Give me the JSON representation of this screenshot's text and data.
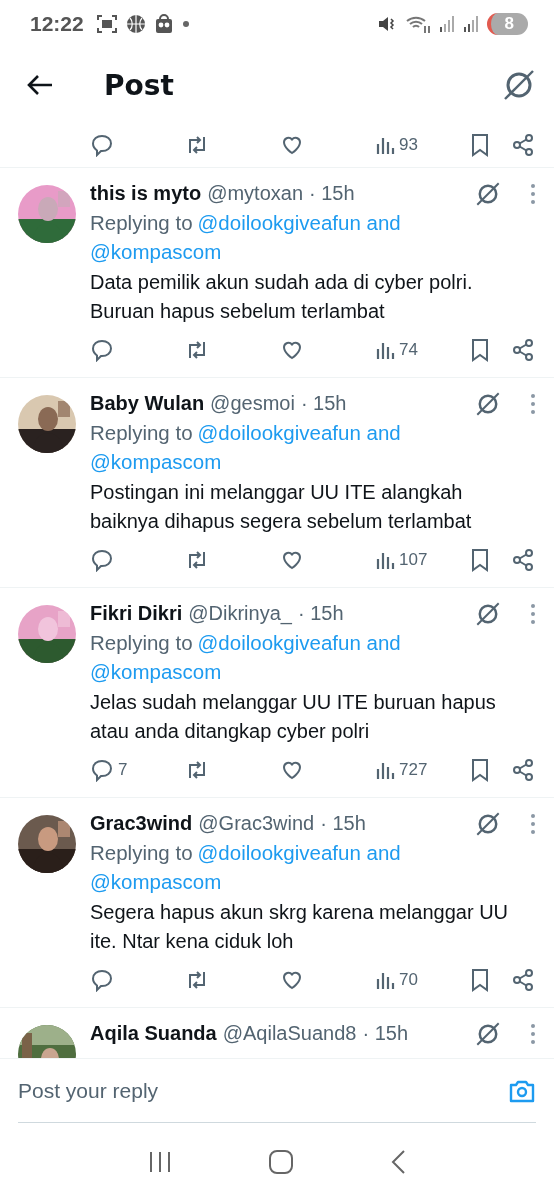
{
  "status_bar": {
    "time": "12:22",
    "battery": "8"
  },
  "header": {
    "title": "Post"
  },
  "top_actions": {
    "views": "93"
  },
  "replies": [
    {
      "name": "this is myto",
      "handle": "@mytoxan",
      "time": "· 15h",
      "replying_label": "Replying to",
      "mentions": [
        "@doilookgiveafun and",
        "@kompascom"
      ],
      "text": "Data pemilik akun sudah ada di cyber polri. Buruan hapus sebelum terlambat",
      "views": "74"
    },
    {
      "name": "Baby Wulan",
      "handle": "@gesmoi",
      "time": "· 15h",
      "replying_label": "Replying to",
      "mentions": [
        "@doilookgiveafun and",
        "@kompascom"
      ],
      "text": "Postingan ini melanggar UU ITE alangkah baiknya dihapus segera sebelum terlambat",
      "views": "107"
    },
    {
      "name": "Fikri Dikri",
      "handle": "@Dikrinya_",
      "time": "· 15h",
      "replying_label": "Replying to",
      "mentions": [
        "@doilookgiveafun and",
        "@kompascom"
      ],
      "text": "Jelas sudah melanggar UU ITE buruan hapus atau anda ditangkap cyber polri",
      "reply_count": "7",
      "views": "727"
    },
    {
      "name": "Grac3wind",
      "handle": "@Grac3wind",
      "time": "· 15h",
      "replying_label": "Replying to",
      "mentions": [
        "@doilookgiveafun and",
        "@kompascom"
      ],
      "text": "Segera hapus akun skrg karena melanggar UU ite. Ntar kena ciduk loh",
      "views": "70"
    }
  ],
  "partial_reply": {
    "name": "Aqila Suanda",
    "handle": "@AqilaSuand8",
    "time": "· 15h"
  },
  "composer": {
    "placeholder": "Post your reply"
  }
}
